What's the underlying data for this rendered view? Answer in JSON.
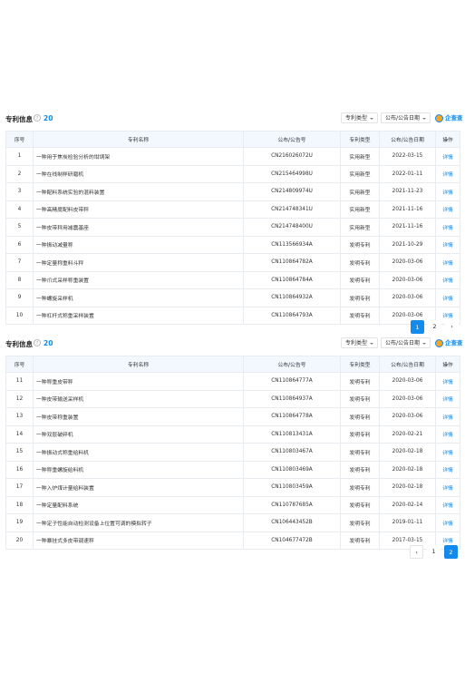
{
  "section1": {
    "title": "专利信息",
    "count": "20",
    "filter_type": "专利类型",
    "filter_date": "公布/公告日期",
    "logo_text": "企查查",
    "headers": [
      "序号",
      "专利名称",
      "公布/公告号",
      "专利类型",
      "公布/公告日期",
      "操作"
    ],
    "rows": [
      [
        "1",
        "一种用于焦炭检验分析的坩埚架",
        "CN216026072U",
        "实用新型",
        "2022-03-15",
        "详情"
      ],
      [
        "2",
        "一种在线制样研磨机",
        "CN215464998U",
        "实用新型",
        "2022-01-11",
        "详情"
      ],
      [
        "3",
        "一种配料系统实验的混料装置",
        "CN214809974U",
        "实用新型",
        "2021-11-23",
        "详情"
      ],
      [
        "4",
        "一种高精度配料皮带秤",
        "CN214748341U",
        "实用新型",
        "2021-11-16",
        "详情"
      ],
      [
        "5",
        "一种皮带秤用减震基座",
        "CN214748400U",
        "实用新型",
        "2021-11-16",
        "详情"
      ],
      [
        "6",
        "一种振动减量称",
        "CN113566934A",
        "发明专利",
        "2021-10-29",
        "详情"
      ],
      [
        "7",
        "一种定量称重料斗秤",
        "CN110864782A",
        "发明专利",
        "2020-03-06",
        "详情"
      ],
      [
        "8",
        "一种爪式采样称重装置",
        "CN110864784A",
        "发明专利",
        "2020-03-06",
        "详情"
      ],
      [
        "9",
        "一种螺旋采样机",
        "CN110864932A",
        "发明专利",
        "2020-03-06",
        "详情"
      ],
      [
        "10",
        "一种杠杆式称重采样装置",
        "CN110864793A",
        "发明专利",
        "2020-03-06",
        "详情"
      ]
    ],
    "pager": [
      "1",
      "2",
      "›"
    ]
  },
  "section2": {
    "title": "专利信息",
    "count": "20",
    "filter_type": "专利类型",
    "filter_date": "公布/公告日期",
    "logo_text": "企查查",
    "headers": [
      "序号",
      "专利名称",
      "公布/公告号",
      "专利类型",
      "公布/公告日期",
      "操作"
    ],
    "rows": [
      [
        "11",
        "一种称重皮带秤",
        "CN110864777A",
        "发明专利",
        "2020-03-06",
        "详情"
      ],
      [
        "12",
        "一种皮带输送采样机",
        "CN110864937A",
        "发明专利",
        "2020-03-06",
        "详情"
      ],
      [
        "13",
        "一种皮带称重装置",
        "CN110864778A",
        "发明专利",
        "2020-03-06",
        "详情"
      ],
      [
        "14",
        "一种双层破碎机",
        "CN110813431A",
        "发明专利",
        "2020-02-21",
        "详情"
      ],
      [
        "15",
        "一种振动式称重给料机",
        "CN110803467A",
        "发明专利",
        "2020-02-18",
        "详情"
      ],
      [
        "16",
        "一种称重螺旋给料机",
        "CN110803469A",
        "发明专利",
        "2020-02-18",
        "详情"
      ],
      [
        "17",
        "一种入炉煤计量给料装置",
        "CN110803459A",
        "发明专利",
        "2020-02-18",
        "详情"
      ],
      [
        "18",
        "一种定量配料系统",
        "CN110787685A",
        "发明专利",
        "2020-02-14",
        "详情"
      ],
      [
        "19",
        "一种定子性能自动检测设备上位置可调的模拟转子",
        "CN106443452B",
        "发明专利",
        "2019-01-11",
        "详情"
      ],
      [
        "20",
        "一种暴挂式多皮带调速秤",
        "CN104677472B",
        "发明专利",
        "2017-03-15",
        "详情"
      ]
    ],
    "pager": [
      "‹",
      "1",
      "2"
    ]
  }
}
